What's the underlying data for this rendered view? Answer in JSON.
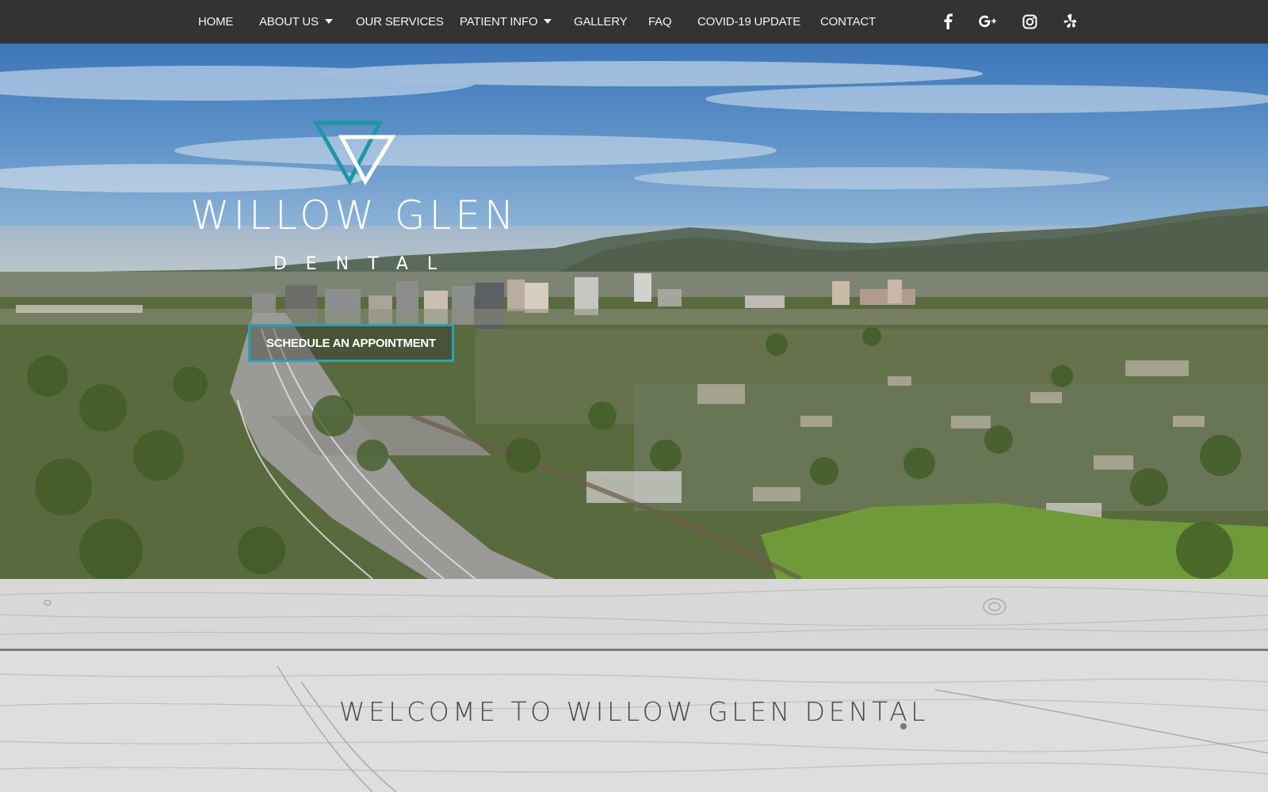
{
  "nav": {
    "items": [
      {
        "label": "HOME",
        "has_dropdown": false
      },
      {
        "label": "ABOUT US",
        "has_dropdown": true
      },
      {
        "label": "OUR SERVICES",
        "has_dropdown": false
      },
      {
        "label": "PATIENT INFO",
        "has_dropdown": true
      },
      {
        "label": "GALLERY",
        "has_dropdown": false
      },
      {
        "label": "FAQ",
        "has_dropdown": false
      },
      {
        "label": "COVID-19 UPDATE",
        "has_dropdown": false
      },
      {
        "label": "CONTACT",
        "has_dropdown": false
      }
    ],
    "social": [
      {
        "icon": "facebook-icon"
      },
      {
        "icon": "google-plus-icon"
      },
      {
        "icon": "instagram-icon"
      },
      {
        "icon": "yelp-icon"
      }
    ]
  },
  "hero": {
    "logo_name": "WILLOW GLEN",
    "logo_sub": "DENTAL",
    "cta_label": "SCHEDULE AN APPOINTMENT"
  },
  "welcome": {
    "heading": "WELCOME TO WILLOW GLEN DENTAL"
  },
  "colors": {
    "nav_bg": "#333333",
    "accent": "#2aa3b0",
    "nav_text": "#f2f2f2"
  }
}
